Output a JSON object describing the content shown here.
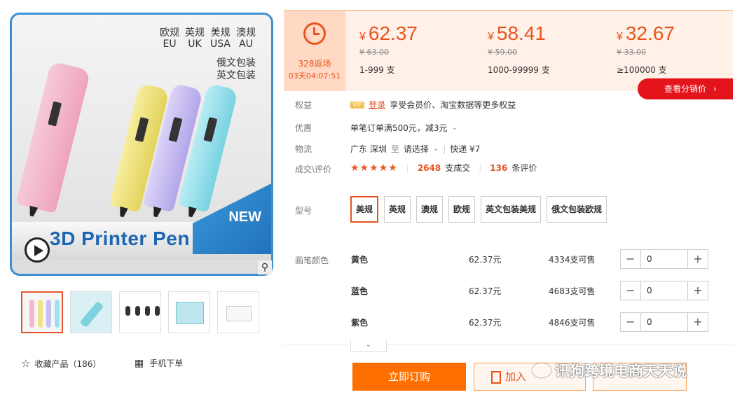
{
  "product": {
    "regions": [
      {
        "cn": "欧规",
        "en": "EU"
      },
      {
        "cn": "英规",
        "en": "UK"
      },
      {
        "cn": "美规",
        "en": "USA"
      },
      {
        "cn": "澳规",
        "en": "AU"
      }
    ],
    "pack_labels": [
      "俄文包装",
      "英文包装"
    ],
    "badge": "NEW",
    "title": "3D Printer Pen",
    "zoom_icon": "magnifier-icon",
    "pen_colors": [
      "#f4b8cc",
      "#f0e48a",
      "#c9bff0",
      "#9fe1ec"
    ]
  },
  "actions": {
    "favorite": "收藏产品（186）",
    "mobile_order": "手机下单"
  },
  "pricing": {
    "promo_title": "328返场",
    "countdown": "03天04:07:51",
    "tiers": [
      {
        "price": "62.37",
        "old": "¥ 63.00",
        "range": "1-999 支"
      },
      {
        "price": "58.41",
        "old": "¥ 59.00",
        "range": "1000-99999 支"
      },
      {
        "price": "32.67",
        "old": "¥ 33.00",
        "range": "≥100000 支"
      }
    ],
    "currency": "¥",
    "dist_button": "查看分销价"
  },
  "info": {
    "rights_label": "权益",
    "vip": "VIP",
    "login": "登录",
    "rights_text": "享受会员价、淘宝数据等更多权益",
    "discount_label": "优惠",
    "discount_text": "单笔订单满500元，减3元",
    "logistics_label": "物流",
    "origin": "广东 深圳",
    "to": "至",
    "dest": "请选择",
    "express": "快递 ¥7",
    "deal_label": "成交\\评价",
    "stars": "★★★★★",
    "deals_num": "2648",
    "deals_unit": "支成交",
    "reviews_num": "136",
    "reviews_unit": "条评价"
  },
  "models": {
    "label": "型号",
    "options": [
      "美规",
      "英规",
      "澳规",
      "欧规",
      "英文包装美规",
      "俄文包装欧规"
    ],
    "selected": 0
  },
  "colors": {
    "label": "画笔颜色",
    "rows": [
      {
        "name": "黄色",
        "price": "62.37元",
        "stock": "4334支可售",
        "qty": "0"
      },
      {
        "name": "蓝色",
        "price": "62.37元",
        "stock": "4683支可售",
        "qty": "0"
      },
      {
        "name": "紫色",
        "price": "62.37元",
        "stock": "4846支可售",
        "qty": "0"
      }
    ]
  },
  "buttons": {
    "buy": "立即订购",
    "cart": "加入"
  },
  "watermark": "讯狗跨境电商天天说"
}
